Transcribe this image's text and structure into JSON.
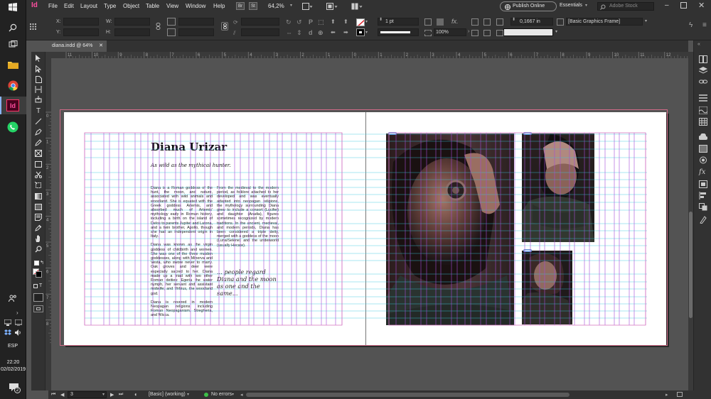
{
  "taskbar": {
    "apps": [
      "search-icon",
      "task-view-icon",
      "file-explorer-icon",
      "chrome-icon",
      "indesign-icon",
      "whatsapp-icon"
    ],
    "tray_lang": "ESP",
    "time": "22:20",
    "date": "02/02/2019",
    "notif_count": "2"
  },
  "app": {
    "logo": "Id",
    "menus": [
      "File",
      "Edit",
      "Layout",
      "Type",
      "Object",
      "Table",
      "View",
      "Window",
      "Help"
    ],
    "bridge": "Br",
    "stock": "St",
    "zoom": "64,2%",
    "publish_label": "Publish Online",
    "workspace": "Essentials",
    "search_placeholder": "Adobe Stock"
  },
  "control": {
    "x_label": "X:",
    "y_label": "Y:",
    "w_label": "W:",
    "h_label": "H:",
    "stroke_weight": "1 pt",
    "opacity": "100%",
    "offset": "0,1667 in",
    "object_style": "[Basic Graphics Frame]"
  },
  "document": {
    "tab_title": "diana.indd @ 64%",
    "ruler_ticks": [
      "11",
      "10",
      "9",
      "8",
      "7",
      "6",
      "5",
      "4",
      "3",
      "2",
      "1",
      "0",
      "1",
      "2",
      "3",
      "4",
      "5",
      "6",
      "7",
      "8",
      "9",
      "10",
      "11",
      "12"
    ],
    "vruler_ticks": [
      "0",
      "1",
      "2",
      "3",
      "4",
      "5",
      "6",
      "7",
      "8"
    ]
  },
  "article": {
    "title": "Diana Urizar",
    "subtitle": "As wild as the mythical hunter.",
    "col1_p1": "Diana is a Roman goddess of the hunt, the moon, and nature, associated with wild animals and woodland. She is equated with the Greek goddess Artemis, and absorbed much of Artemis' mythology early in Roman history, including a birth on the island of Delos to parents Jupiter and Latona, and a twin brother, Apollo, though she had an independent origin in Italy.",
    "col1_p2": "Diana was known as the virgin goddess of childbirth and women. She was one of the three maiden goddesses, along with Minerva and Vesta, who swore never to marry. Oak groves and deer were especially sacred to her. Diana made up a triad with two other Roman deities: Egeria the water nymph, her servant and assistant midwife; and Virbius, the woodland god.",
    "col1_p3": "Diana is revered in modern Neopagan religions including Roman Neopaganism, Stregheria, and Wicca.",
    "col2_p1": "From the medieval to the modern period, as folklore attached to her developed and was eventually adapted into neopagan religions, the mythology surrounding Diana grew to include a consort (Lucifer) and daughter (Aradia), figures sometimes recognized by modern traditions. In the ancient, medieval, and modern periods, Diana has been considered a triple deity, merged with a goddess of the moon (Luna/Selene) and the underworld (usually Hecate).",
    "quote": "... people regard Diana and the moon as one and the same..."
  },
  "status": {
    "page": "3",
    "master": "[Basic] (working)",
    "errors": "No errors"
  },
  "colors": {
    "margin": "#d77ac0",
    "column_guide": "#a64bd8",
    "baseline": "#39c7df",
    "accent": "#ff4fa0"
  }
}
